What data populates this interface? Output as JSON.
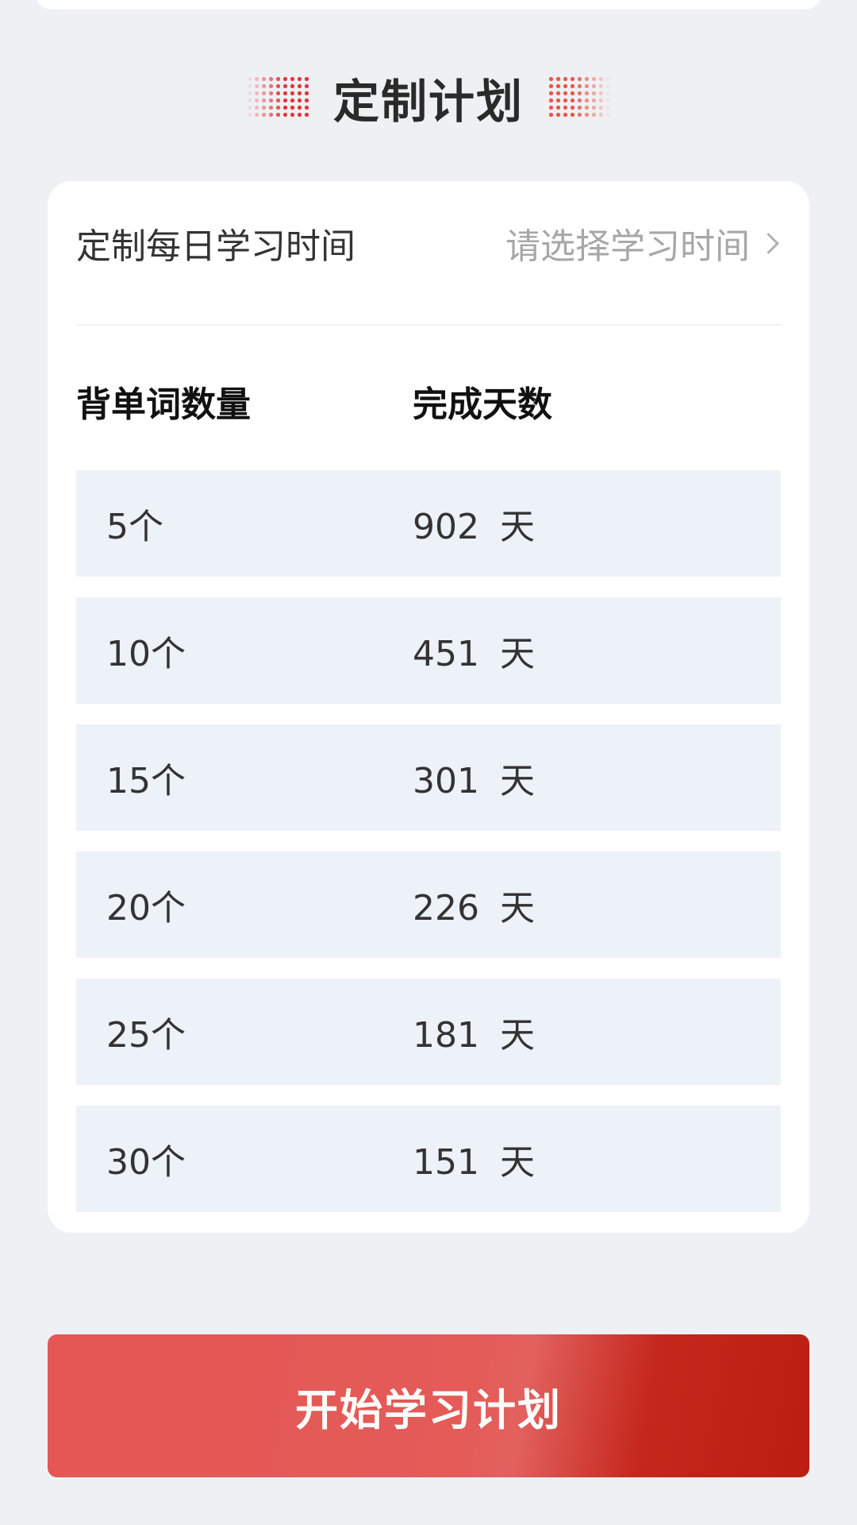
{
  "section": {
    "title": "定制计划"
  },
  "plan": {
    "time_label": "定制每日学习时间",
    "time_placeholder": "请选择学习时间",
    "headers": {
      "words": "背单词数量",
      "days": "完成天数"
    },
    "rows": [
      {
        "words": "5个",
        "days": "902 天"
      },
      {
        "words": "10个",
        "days": "451 天"
      },
      {
        "words": "15个",
        "days": "301 天"
      },
      {
        "words": "20个",
        "days": "226 天"
      },
      {
        "words": "25个",
        "days": "181 天"
      },
      {
        "words": "30个",
        "days": "151 天"
      }
    ]
  },
  "start_button": {
    "label": "开始学习计划"
  },
  "colors": {
    "accent": "#e0393e",
    "button_start": "#e45755",
    "button_end": "#bb1e10",
    "row_bg": "#edf1f8",
    "page_bg": "#eff0f3"
  },
  "icons": {
    "time_picker": "chevron-right-icon",
    "header_decoration": "dot-grid-icon"
  }
}
